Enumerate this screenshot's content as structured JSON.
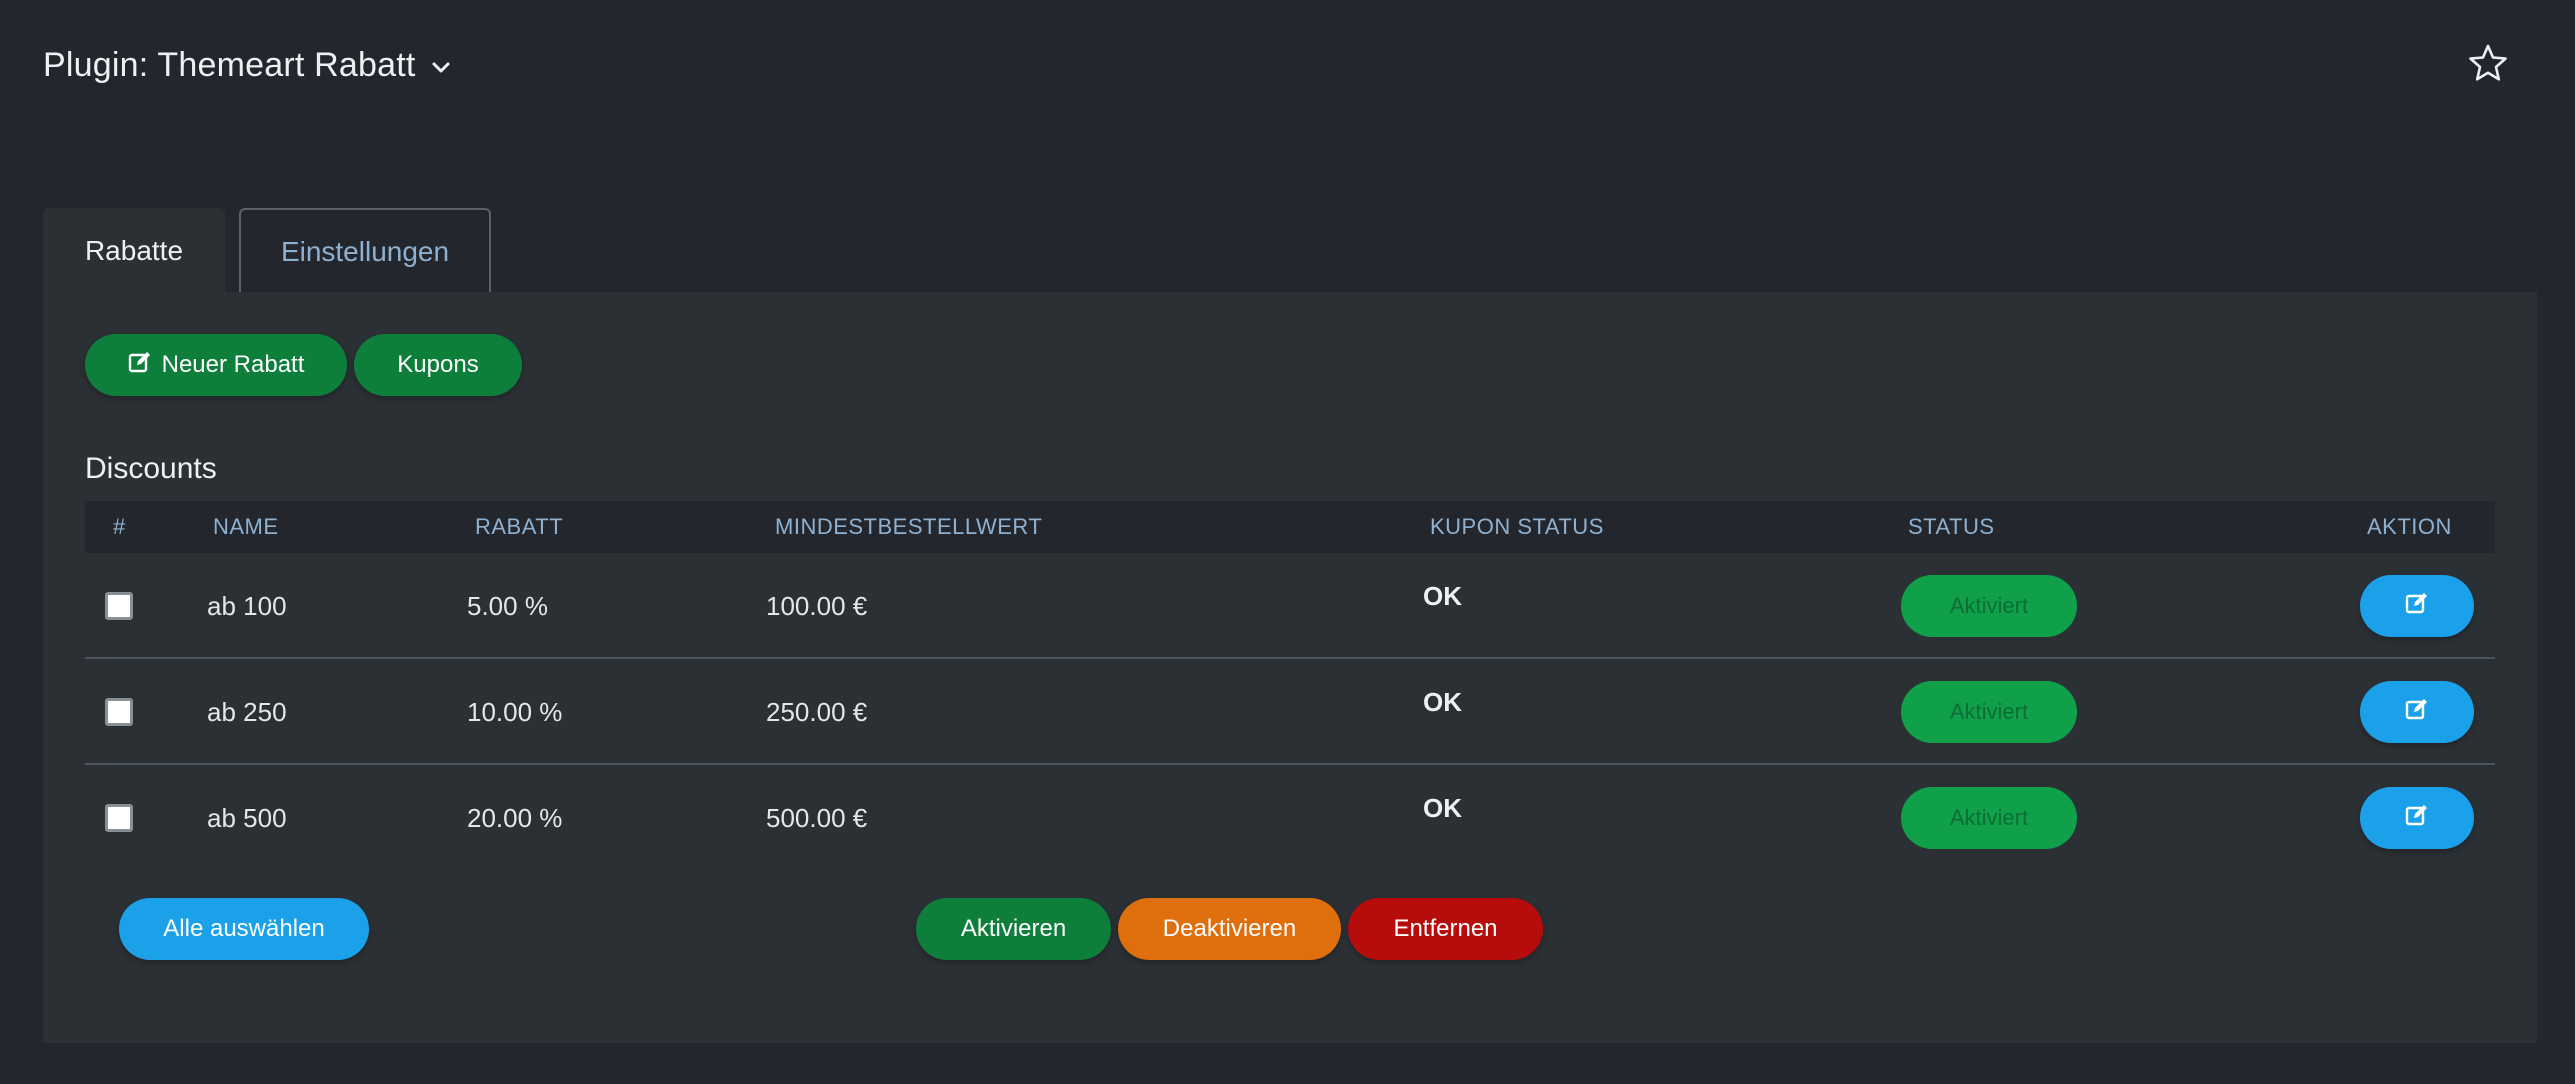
{
  "header": {
    "title": "Plugin: Themeart Rabatt",
    "dropdown_icon": "chevron-down-icon",
    "favorite_icon": "star-icon"
  },
  "tabs": [
    {
      "label": "Rabatte",
      "active": true
    },
    {
      "label": "Einstellungen",
      "active": false
    }
  ],
  "toolbar": {
    "new_discount_label": "Neuer Rabatt",
    "new_discount_icon": "edit-icon",
    "coupons_label": "Kupons"
  },
  "section": {
    "title": "Discounts"
  },
  "table": {
    "columns": [
      "#",
      "NAME",
      "RABATT",
      "MINDESTBESTELLWERT",
      "KUPON STATUS",
      "STATUS",
      "AKTION"
    ],
    "rows": [
      {
        "checked": false,
        "name": "ab 100",
        "discount": "5.00 %",
        "min_order": "100.00 €",
        "coupon_status": "OK",
        "status": "Aktiviert"
      },
      {
        "checked": false,
        "name": "ab 250",
        "discount": "10.00 %",
        "min_order": "250.00 €",
        "coupon_status": "OK",
        "status": "Aktiviert"
      },
      {
        "checked": false,
        "name": "ab 500",
        "discount": "20.00 %",
        "min_order": "500.00 €",
        "coupon_status": "OK",
        "status": "Aktiviert"
      }
    ]
  },
  "bulk_actions": {
    "select_all_label": "Alle auswählen",
    "activate_label": "Aktivieren",
    "deactivate_label": "Deaktivieren",
    "remove_label": "Entfernen"
  },
  "colors": {
    "background": "#23272d",
    "panel": "#2b3035",
    "green": "#0e7f3b",
    "status_green": "#0fa049",
    "blue": "#1ba1ea",
    "orange": "#df6f0d",
    "red": "#b70c0c",
    "header_text": "#8fb1d1"
  }
}
